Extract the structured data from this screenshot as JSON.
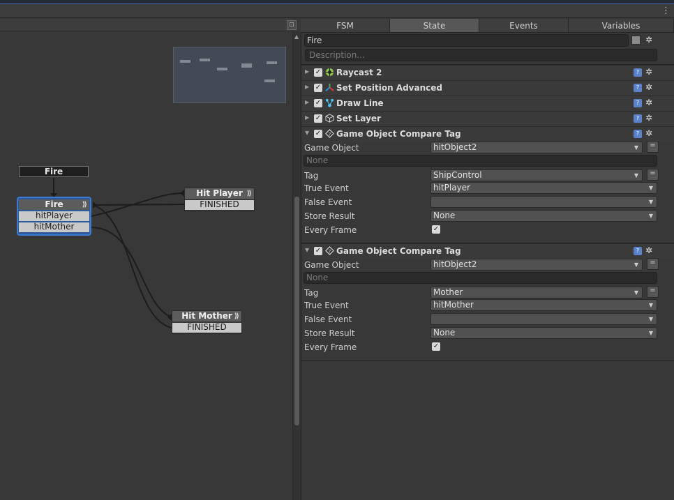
{
  "toolbar": {
    "menu_glyph": "⋮"
  },
  "graph": {
    "toggle_glyph": "⊡",
    "start_label": "Fire",
    "nodes": {
      "fire": {
        "title": "Fire",
        "transitions": [
          "hitPlayer",
          "hitMother"
        ]
      },
      "hit_player": {
        "title": "Hit Player",
        "transitions": [
          "FINISHED"
        ]
      },
      "hit_mother": {
        "title": "Hit Mother",
        "transitions": [
          "FINISHED"
        ]
      }
    },
    "colors": {
      "selected_border": "#3b7bd4",
      "link": "#1c1c1c"
    }
  },
  "inspector": {
    "tabs": [
      "FSM",
      "State",
      "Events",
      "Variables"
    ],
    "active_tab": "State",
    "state_name": "Fire",
    "description_placeholder": "Description...",
    "actions": [
      {
        "title": "Raycast 2",
        "icon": "raycast-icon"
      },
      {
        "title": "Set Position Advanced",
        "icon": "transform-icon"
      },
      {
        "title": "Draw Line",
        "icon": "draw-line-icon"
      },
      {
        "title": "Set Layer",
        "icon": "cube-icon"
      }
    ],
    "compare_1": {
      "title": "Game Object Compare Tag",
      "game_object_label": "Game Object",
      "game_object_value": "hitObject2",
      "none_placeholder": "None",
      "tag_label": "Tag",
      "tag_value": "ShipControl",
      "true_event_label": "True Event",
      "true_event_value": "hitPlayer",
      "false_event_label": "False Event",
      "false_event_value": "",
      "store_result_label": "Store Result",
      "store_result_value": "None",
      "every_frame_label": "Every Frame",
      "every_frame_checked": true
    },
    "compare_2": {
      "title": "Game Object Compare Tag",
      "game_object_label": "Game Object",
      "game_object_value": "hitObject2",
      "none_placeholder": "None",
      "tag_label": "Tag",
      "tag_value": "Mother",
      "true_event_label": "True Event",
      "true_event_value": "hitMother",
      "false_event_label": "False Event",
      "false_event_value": "",
      "store_result_label": "Store Result",
      "store_result_value": "None",
      "every_frame_label": "Every Frame",
      "every_frame_checked": true
    },
    "glyphs": {
      "check": "✓",
      "gear": "✲",
      "help": "?",
      "fold_open": "▼",
      "fold_closed": "▶",
      "dropdown": "▼",
      "minus": "="
    }
  }
}
